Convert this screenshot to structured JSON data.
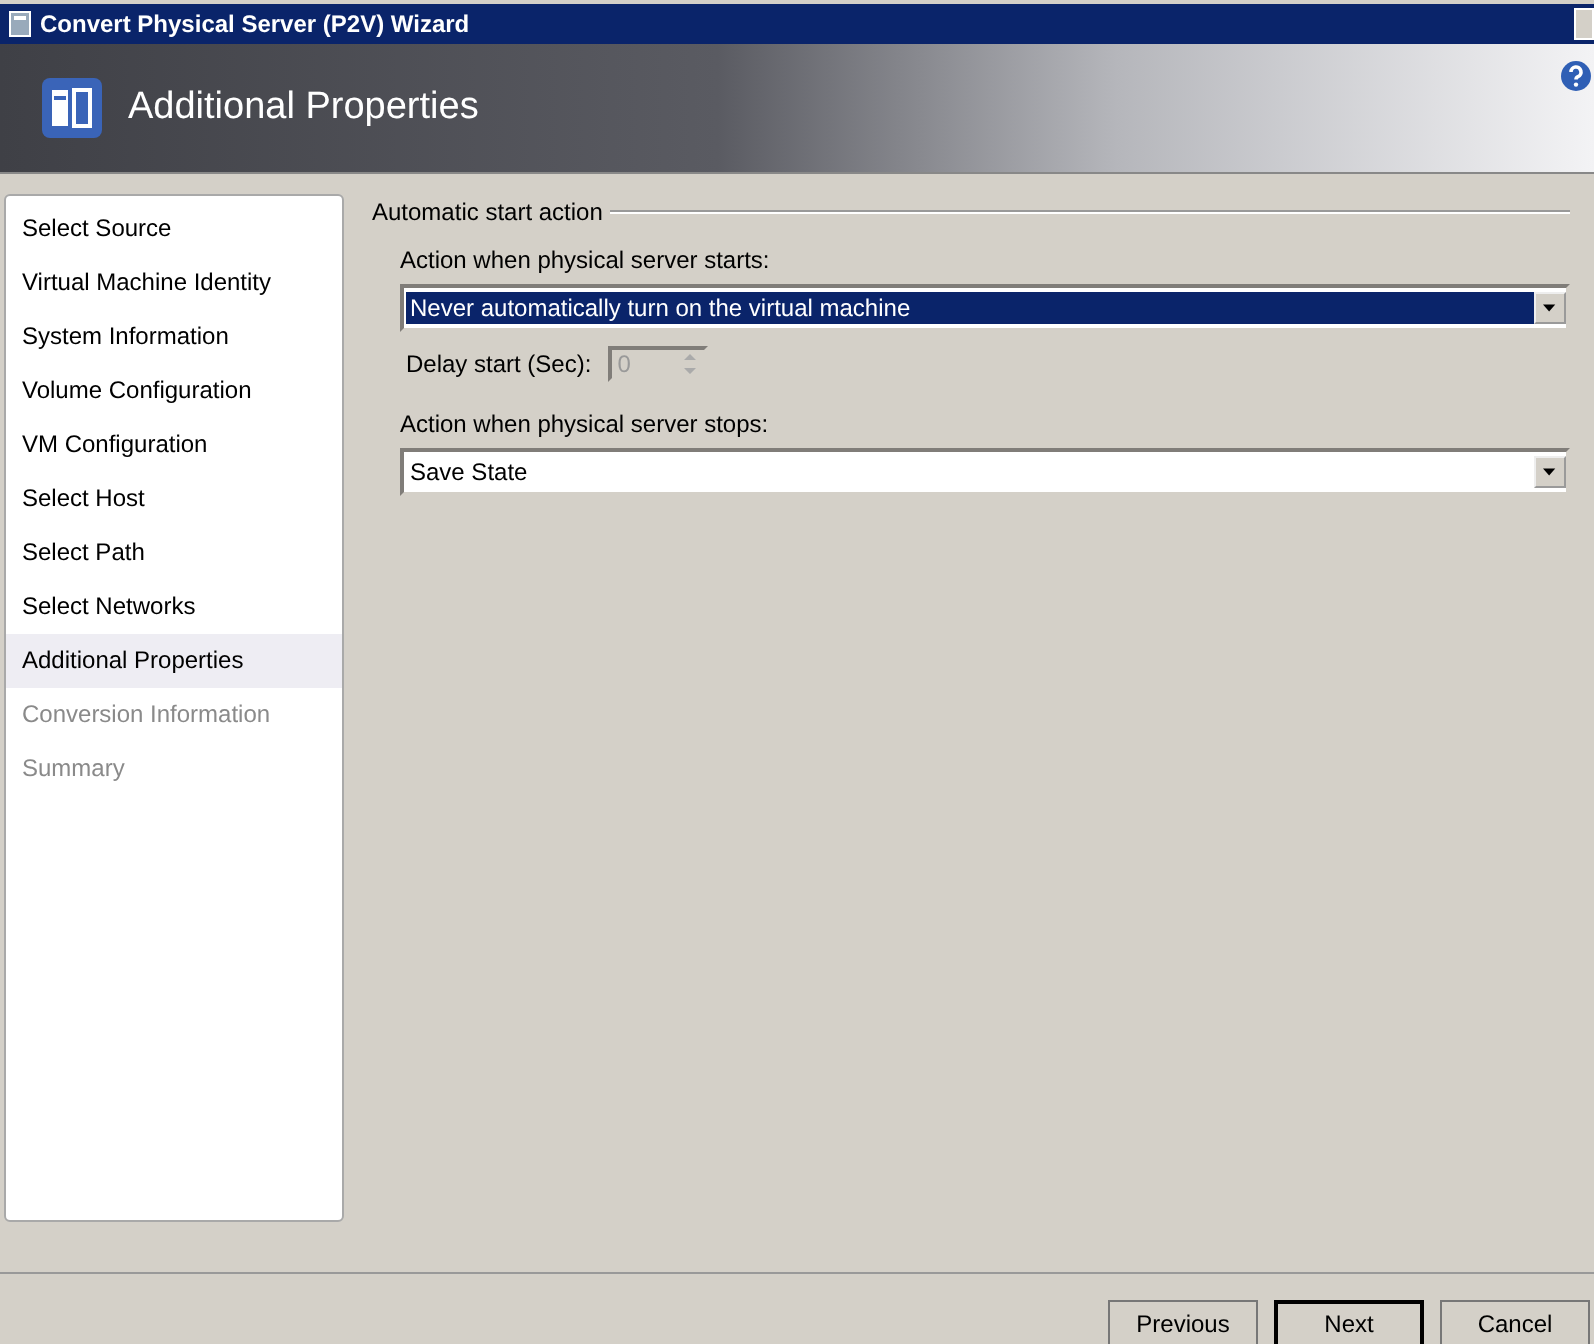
{
  "window": {
    "title": "Convert Physical Server (P2V) Wizard"
  },
  "header": {
    "title": "Additional Properties"
  },
  "steps": [
    {
      "label": "Select Source",
      "selected": false,
      "disabled": false
    },
    {
      "label": "Virtual Machine Identity",
      "selected": false,
      "disabled": false
    },
    {
      "label": "System Information",
      "selected": false,
      "disabled": false
    },
    {
      "label": "Volume Configuration",
      "selected": false,
      "disabled": false
    },
    {
      "label": "VM Configuration",
      "selected": false,
      "disabled": false
    },
    {
      "label": "Select Host",
      "selected": false,
      "disabled": false
    },
    {
      "label": "Select Path",
      "selected": false,
      "disabled": false
    },
    {
      "label": "Select Networks",
      "selected": false,
      "disabled": false
    },
    {
      "label": "Additional Properties",
      "selected": true,
      "disabled": false
    },
    {
      "label": "Conversion Information",
      "selected": false,
      "disabled": true
    },
    {
      "label": "Summary",
      "selected": false,
      "disabled": true
    }
  ],
  "group": {
    "title": "Automatic start action",
    "start_label": "Action when physical server starts:",
    "start_value": "Never automatically turn on the virtual machine",
    "start_focused": true,
    "delay_label": "Delay start (Sec):",
    "delay_value": "0",
    "delay_disabled": true,
    "stop_label": "Action when physical server stops:",
    "stop_value": "Save State",
    "stop_focused": false
  },
  "buttons": [
    "Previous",
    "Next",
    "Cancel"
  ]
}
